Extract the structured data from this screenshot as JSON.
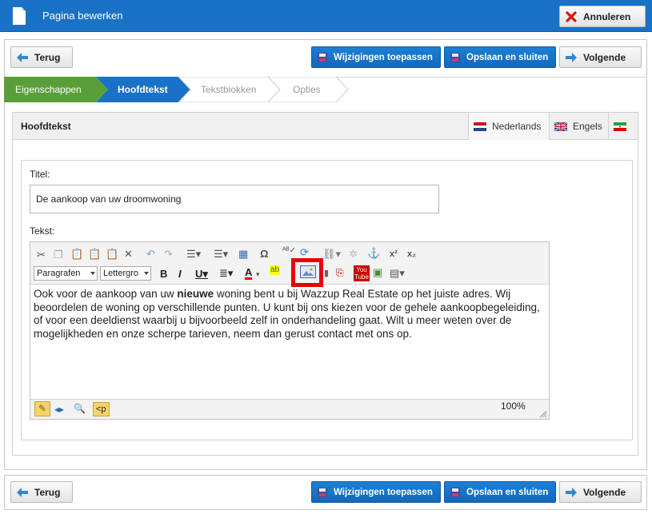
{
  "titlebar": {
    "title": "Pagina bewerken"
  },
  "actions": {
    "cancel_label": "Annuleren",
    "back_label": "Terug",
    "apply_label": "Wijzigingen toepassen",
    "save_close_label": "Opslaan en sluiten",
    "next_label": "Volgende"
  },
  "wizard": {
    "steps": [
      {
        "label": "Eigenschappen",
        "state": "done"
      },
      {
        "label": "Hoofdtekst",
        "state": "active"
      },
      {
        "label": "Tekstblokken",
        "state": "pending"
      },
      {
        "label": "Opties",
        "state": "pending"
      }
    ]
  },
  "panel": {
    "title": "Hoofdtekst",
    "languages": [
      {
        "label": "Nederlands",
        "flag": "flag-nl-icon"
      },
      {
        "label": "Engels",
        "flag": "flag-uk-icon"
      },
      {
        "label": "",
        "flag": "flag-ir-icon"
      }
    ]
  },
  "form": {
    "title_label": "Titel:",
    "title_value": "De aankoop van uw droomwoning",
    "text_label": "Tekst:"
  },
  "editor": {
    "format_combo": "Paragrafen",
    "font_combo": "Lettergro",
    "content_before": "Ook voor de aankoop van uw ",
    "content_bold": "nieuwe",
    "content_after": " woning bent u bij Wazzup Real Estate op het juiste adres. Wij beoordelen de woning op verschillende punten. U kunt bij ons kiezen voor de gehele aankoopbegeleiding, of voor een deeldienst waarbij u bijvoorbeeld zelf in onderhandeling gaat. Wilt u meer weten over de mogelijkheden en onze scherpe tarieven, neem dan gerust contact met ons op.",
    "tag_label": "<p",
    "zoom": "100%"
  },
  "colors": {
    "accent": "#1a72c6",
    "done_step": "#5a9e3a",
    "active_step": "#1a72c6",
    "highlight": "#e8000b"
  }
}
